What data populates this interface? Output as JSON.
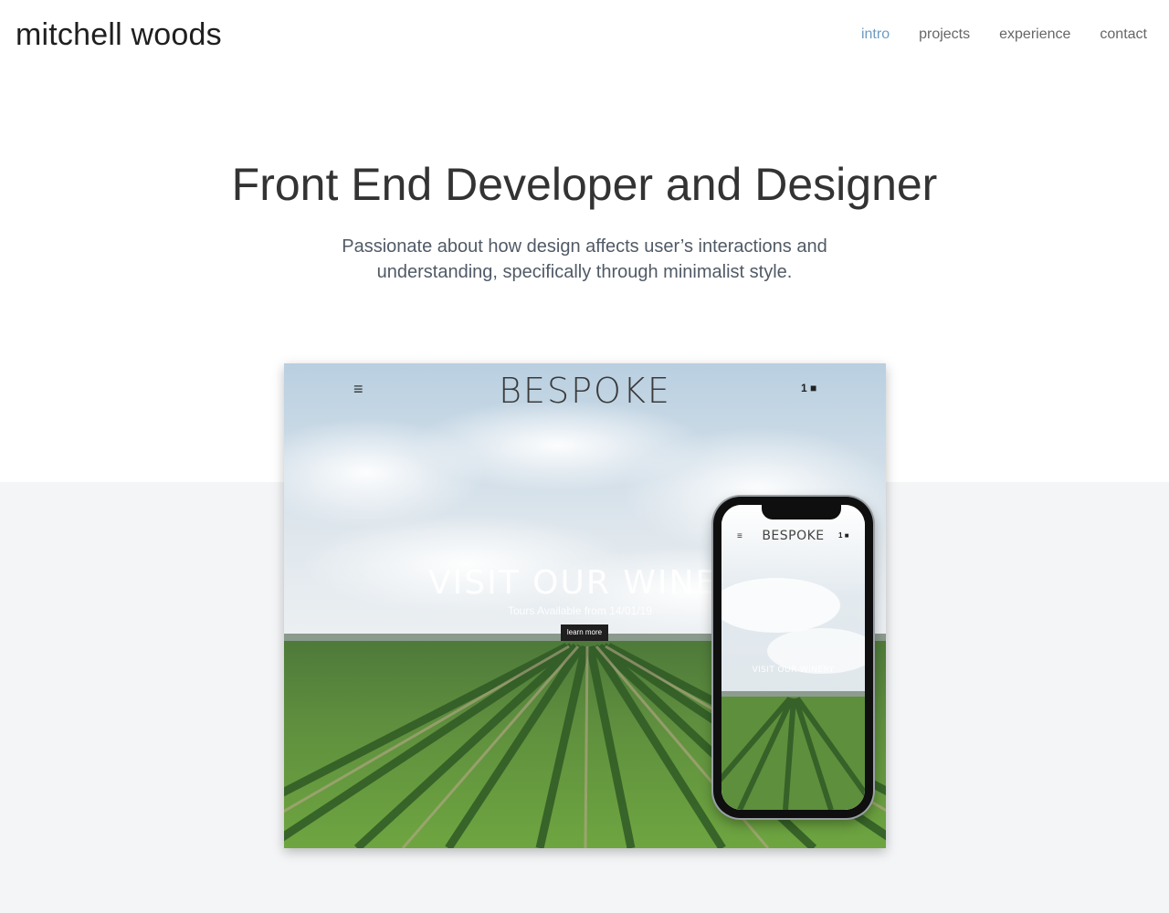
{
  "header": {
    "brand": "mitchell woods",
    "nav": [
      {
        "label": "intro",
        "active": true
      },
      {
        "label": "projects",
        "active": false
      },
      {
        "label": "experience",
        "active": false
      },
      {
        "label": "contact",
        "active": false
      }
    ]
  },
  "hero": {
    "title": "Front End Developer and Designer",
    "subtitle": "Passionate about how design affects user’s interactions and understanding, specifically through minimalist style."
  },
  "project_mockup": {
    "desktop": {
      "logo": "BESPOKE",
      "menu_icon": "hamburger-icon",
      "cart_count": "1",
      "cart_icon": "shopping-bag-icon",
      "headline": "VISIT OUR WINERY",
      "subline": "Tours Available from 14/01/19",
      "button_label": "learn more"
    },
    "phone": {
      "logo": "BESPOKE",
      "cart_count": "1",
      "headline": "VISIT OUR WINERY"
    }
  },
  "colors": {
    "nav_active": "#6d9bc3",
    "nav_default": "#666666",
    "title": "#333333",
    "band": "#f4f5f7"
  }
}
